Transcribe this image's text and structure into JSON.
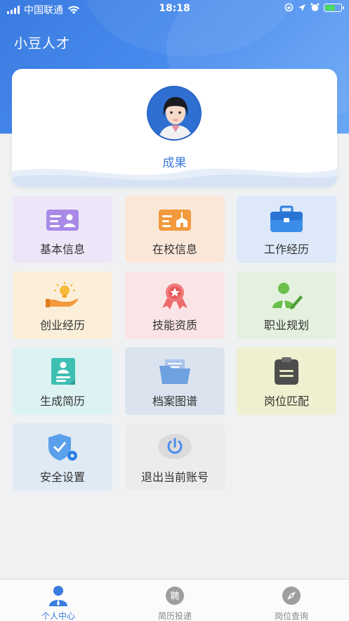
{
  "status_bar": {
    "carrier": "中国联通",
    "time": "18:18"
  },
  "app": {
    "title": "小豆人才"
  },
  "profile": {
    "name": "成果"
  },
  "menu": [
    {
      "label": "基本信息",
      "icon": "id-card-icon",
      "bg": "#ece6f8"
    },
    {
      "label": "在校信息",
      "icon": "school-card-icon",
      "bg": "#fbe7d8"
    },
    {
      "label": "工作经历",
      "icon": "briefcase-icon",
      "bg": "#dde9f8"
    },
    {
      "label": "创业经历",
      "icon": "idea-hand-icon",
      "bg": "#fbefd9"
    },
    {
      "label": "技能资质",
      "icon": "award-ribbon-icon",
      "bg": "#fbe4e6"
    },
    {
      "label": "职业规划",
      "icon": "career-plan-icon",
      "bg": "#e4f1df"
    },
    {
      "label": "生成简历",
      "icon": "resume-icon",
      "bg": "#dcf2f3"
    },
    {
      "label": "档案图谱",
      "icon": "folder-icon",
      "bg": "#dbe4ee"
    },
    {
      "label": "岗位匹配",
      "icon": "clipboard-icon",
      "bg": "#eef0cf"
    },
    {
      "label": "安全设置",
      "icon": "shield-gear-icon",
      "bg": "#dfeaf5"
    },
    {
      "label": "退出当前账号",
      "icon": "power-icon",
      "bg": "#ececec"
    }
  ],
  "tabs": [
    {
      "label": "个人中心",
      "icon": "person-icon",
      "active": true
    },
    {
      "label": "简历投递",
      "icon": "hire-icon",
      "active": false
    },
    {
      "label": "岗位查询",
      "icon": "compass-icon",
      "active": false
    }
  ],
  "colors": {
    "primary": "#3a7be0",
    "background": "#f0f1f3"
  }
}
